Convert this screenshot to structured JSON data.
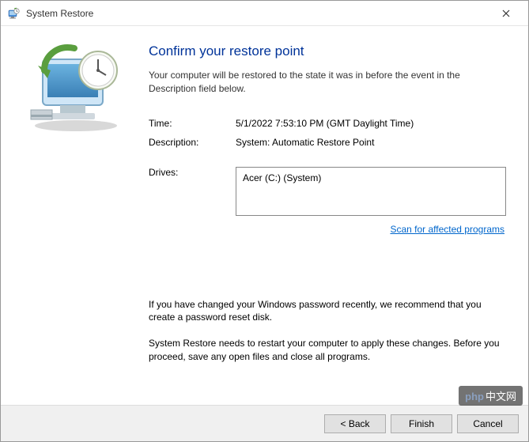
{
  "titlebar": {
    "title": "System Restore"
  },
  "heading": "Confirm your restore point",
  "subtext": "Your computer will be restored to the state it was in before the event in the Description field below.",
  "info": {
    "time_label": "Time:",
    "time_value": "5/1/2022 7:53:10 PM (GMT Daylight Time)",
    "description_label": "Description:",
    "description_value": "System: Automatic Restore Point",
    "drives_label": "Drives:",
    "drives_value": "Acer (C:) (System)"
  },
  "scan_link": "Scan for affected programs",
  "warnings": {
    "password": "If you have changed your Windows password recently, we recommend that you create a password reset disk.",
    "restart": "System Restore needs to restart your computer to apply these changes. Before you proceed, save any open files and close all programs."
  },
  "buttons": {
    "back": "< Back",
    "finish": "Finish",
    "cancel": "Cancel"
  },
  "watermark": {
    "prefix": "php",
    "text": "中文网"
  }
}
